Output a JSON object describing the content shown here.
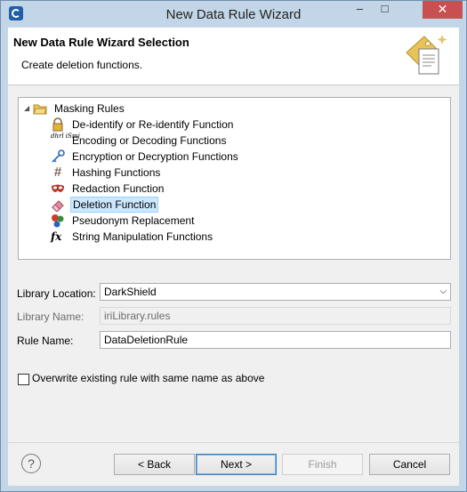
{
  "window": {
    "title": "New Data Rule Wizard",
    "minimize_glyph": "‒",
    "maximize_glyph": "□",
    "close_glyph": "✕"
  },
  "header": {
    "title": "New Data Rule Wizard Selection",
    "subtitle": "Create deletion functions."
  },
  "tree": {
    "root": {
      "label": "Masking Rules",
      "expand_glyph": "◢",
      "icon": "folder-icon"
    },
    "items": [
      {
        "label": "De-identify or Re-identify Function",
        "icon": "lock-icon"
      },
      {
        "label": "Encoding or Decoding Functions",
        "icon": "encode-icon",
        "icon_text": "dhrl iSmj"
      },
      {
        "label": "Encryption or Decryption Functions",
        "icon": "key-icon"
      },
      {
        "label": "Hashing Functions",
        "icon": "hash-icon",
        "icon_text": "#"
      },
      {
        "label": "Redaction Function",
        "icon": "mask-icon"
      },
      {
        "label": "Deletion Function",
        "icon": "eraser-icon",
        "selected": true
      },
      {
        "label": "Pseudonym Replacement",
        "icon": "pseudonym-icon"
      },
      {
        "label": "String Manipulation Functions",
        "icon": "function-icon",
        "icon_text": "fx"
      }
    ]
  },
  "form": {
    "library_location": {
      "label": "Library Location:",
      "value": "DarkShield"
    },
    "library_name": {
      "label": "Library Name:",
      "value": "iriLibrary.rules"
    },
    "rule_name": {
      "label": "Rule Name:",
      "value": "DataDeletionRule"
    }
  },
  "overwrite": {
    "label": "Overwrite existing rule with same name as above",
    "checked": false
  },
  "buttons": {
    "help": "?",
    "back": "< Back",
    "next": "Next >",
    "finish": "Finish",
    "cancel": "Cancel"
  },
  "colors": {
    "selection_bg": "#cce8ff",
    "close_button": "#c75050",
    "window_frame": "#c3d6e8"
  }
}
